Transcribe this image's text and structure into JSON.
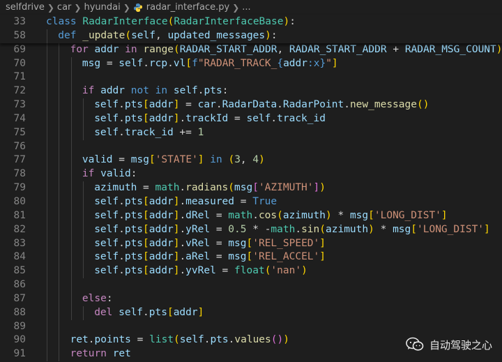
{
  "breadcrumb": {
    "items": [
      "selfdrive",
      "car",
      "hyundai",
      "radar_interface.py",
      "..."
    ],
    "separator": ">"
  },
  "sticky_lines": [
    {
      "n": "33",
      "indent": 0,
      "tokens": [
        [
          "kw",
          "class "
        ],
        [
          "cls",
          "RadarInterface"
        ],
        [
          "b1",
          "("
        ],
        [
          "cls",
          "RadarInterfaceBase"
        ],
        [
          "b1",
          ")"
        ],
        [
          "pl",
          ":"
        ]
      ]
    },
    {
      "n": "58",
      "indent": 1,
      "tokens": [
        [
          "kw",
          "def "
        ],
        [
          "fn",
          "_update"
        ],
        [
          "b1",
          "("
        ],
        [
          "var",
          "self"
        ],
        [
          "pl",
          ", "
        ],
        [
          "var",
          "updated_messages"
        ],
        [
          "b1",
          ")"
        ],
        [
          "pl",
          ":"
        ]
      ]
    }
  ],
  "lines": [
    {
      "n": "69",
      "indent": 2,
      "tokens": [
        [
          "ctl",
          "for "
        ],
        [
          "var",
          "addr "
        ],
        [
          "ctl",
          "in "
        ],
        [
          "fn",
          "range"
        ],
        [
          "b1",
          "("
        ],
        [
          "var",
          "RADAR_START_ADDR"
        ],
        [
          "pl",
          ", "
        ],
        [
          "var",
          "RADAR_START_ADDR"
        ],
        [
          "pl",
          " + "
        ],
        [
          "var",
          "RADAR_MSG_COUNT"
        ],
        [
          "b1",
          ")"
        ],
        [
          "pl",
          ":"
        ]
      ]
    },
    {
      "n": "70",
      "indent": 3,
      "tokens": [
        [
          "var",
          "msg"
        ],
        [
          "pl",
          " = "
        ],
        [
          "var",
          "self"
        ],
        [
          "pl",
          "."
        ],
        [
          "var",
          "rcp"
        ],
        [
          "pl",
          "."
        ],
        [
          "var",
          "vl"
        ],
        [
          "b1",
          "["
        ],
        [
          "kw",
          "f"
        ],
        [
          "str",
          "\"RADAR_TRACK_"
        ],
        [
          "kw",
          "{"
        ],
        [
          "var",
          "addr"
        ],
        [
          "kw",
          ":x}"
        ],
        [
          "str",
          "\""
        ],
        [
          "b1",
          "]"
        ]
      ]
    },
    {
      "n": "71",
      "indent": 3,
      "tokens": []
    },
    {
      "n": "72",
      "indent": 3,
      "tokens": [
        [
          "ctl",
          "if "
        ],
        [
          "var",
          "addr "
        ],
        [
          "kw",
          "not in "
        ],
        [
          "var",
          "self"
        ],
        [
          "pl",
          "."
        ],
        [
          "var",
          "pts"
        ],
        [
          "pl",
          ":"
        ]
      ]
    },
    {
      "n": "73",
      "indent": 4,
      "tokens": [
        [
          "var",
          "self"
        ],
        [
          "pl",
          "."
        ],
        [
          "var",
          "pts"
        ],
        [
          "b1",
          "["
        ],
        [
          "var",
          "addr"
        ],
        [
          "b1",
          "]"
        ],
        [
          "pl",
          " = "
        ],
        [
          "var",
          "car"
        ],
        [
          "pl",
          "."
        ],
        [
          "var",
          "RadarData"
        ],
        [
          "pl",
          "."
        ],
        [
          "var",
          "RadarPoint"
        ],
        [
          "pl",
          "."
        ],
        [
          "fn",
          "new_message"
        ],
        [
          "b1",
          "()"
        ]
      ]
    },
    {
      "n": "74",
      "indent": 4,
      "tokens": [
        [
          "var",
          "self"
        ],
        [
          "pl",
          "."
        ],
        [
          "var",
          "pts"
        ],
        [
          "b1",
          "["
        ],
        [
          "var",
          "addr"
        ],
        [
          "b1",
          "]"
        ],
        [
          "pl",
          "."
        ],
        [
          "var",
          "trackId"
        ],
        [
          "pl",
          " = "
        ],
        [
          "var",
          "self"
        ],
        [
          "pl",
          "."
        ],
        [
          "var",
          "track_id"
        ]
      ]
    },
    {
      "n": "75",
      "indent": 4,
      "tokens": [
        [
          "var",
          "self"
        ],
        [
          "pl",
          "."
        ],
        [
          "var",
          "track_id"
        ],
        [
          "pl",
          " += "
        ],
        [
          "num",
          "1"
        ]
      ]
    },
    {
      "n": "76",
      "indent": 3,
      "tokens": []
    },
    {
      "n": "77",
      "indent": 3,
      "tokens": [
        [
          "var",
          "valid"
        ],
        [
          "pl",
          " = "
        ],
        [
          "var",
          "msg"
        ],
        [
          "b1",
          "["
        ],
        [
          "str",
          "'STATE'"
        ],
        [
          "b1",
          "]"
        ],
        [
          "kw",
          " in "
        ],
        [
          "b1",
          "("
        ],
        [
          "num",
          "3"
        ],
        [
          "pl",
          ", "
        ],
        [
          "num",
          "4"
        ],
        [
          "b1",
          ")"
        ]
      ]
    },
    {
      "n": "78",
      "indent": 3,
      "tokens": [
        [
          "ctl",
          "if "
        ],
        [
          "var",
          "valid"
        ],
        [
          "pl",
          ":"
        ]
      ]
    },
    {
      "n": "79",
      "indent": 4,
      "tokens": [
        [
          "var",
          "azimuth"
        ],
        [
          "pl",
          " = "
        ],
        [
          "cls",
          "math"
        ],
        [
          "pl",
          "."
        ],
        [
          "fn",
          "radians"
        ],
        [
          "b1",
          "("
        ],
        [
          "var",
          "msg"
        ],
        [
          "b2",
          "["
        ],
        [
          "str",
          "'AZIMUTH'"
        ],
        [
          "b2",
          "]"
        ],
        [
          "b1",
          ")"
        ]
      ]
    },
    {
      "n": "80",
      "indent": 4,
      "tokens": [
        [
          "var",
          "self"
        ],
        [
          "pl",
          "."
        ],
        [
          "var",
          "pts"
        ],
        [
          "b1",
          "["
        ],
        [
          "var",
          "addr"
        ],
        [
          "b1",
          "]"
        ],
        [
          "pl",
          "."
        ],
        [
          "var",
          "measured"
        ],
        [
          "pl",
          " = "
        ],
        [
          "kw",
          "True"
        ]
      ]
    },
    {
      "n": "81",
      "indent": 4,
      "tokens": [
        [
          "var",
          "self"
        ],
        [
          "pl",
          "."
        ],
        [
          "var",
          "pts"
        ],
        [
          "b1",
          "["
        ],
        [
          "var",
          "addr"
        ],
        [
          "b1",
          "]"
        ],
        [
          "pl",
          "."
        ],
        [
          "var",
          "dRel"
        ],
        [
          "pl",
          " = "
        ],
        [
          "cls",
          "math"
        ],
        [
          "pl",
          "."
        ],
        [
          "fn",
          "cos"
        ],
        [
          "b1",
          "("
        ],
        [
          "var",
          "azimuth"
        ],
        [
          "b1",
          ")"
        ],
        [
          "pl",
          " * "
        ],
        [
          "var",
          "msg"
        ],
        [
          "b1",
          "["
        ],
        [
          "str",
          "'LONG_DIST'"
        ],
        [
          "b1",
          "]"
        ]
      ]
    },
    {
      "n": "82",
      "indent": 4,
      "tokens": [
        [
          "var",
          "self"
        ],
        [
          "pl",
          "."
        ],
        [
          "var",
          "pts"
        ],
        [
          "b1",
          "["
        ],
        [
          "var",
          "addr"
        ],
        [
          "b1",
          "]"
        ],
        [
          "pl",
          "."
        ],
        [
          "var",
          "yRel"
        ],
        [
          "pl",
          " = "
        ],
        [
          "num",
          "0.5"
        ],
        [
          "pl",
          " * -"
        ],
        [
          "cls",
          "math"
        ],
        [
          "pl",
          "."
        ],
        [
          "fn",
          "sin"
        ],
        [
          "b1",
          "("
        ],
        [
          "var",
          "azimuth"
        ],
        [
          "b1",
          ")"
        ],
        [
          "pl",
          " * "
        ],
        [
          "var",
          "msg"
        ],
        [
          "b1",
          "["
        ],
        [
          "str",
          "'LONG_DIST'"
        ],
        [
          "b1",
          "]"
        ]
      ]
    },
    {
      "n": "83",
      "indent": 4,
      "tokens": [
        [
          "var",
          "self"
        ],
        [
          "pl",
          "."
        ],
        [
          "var",
          "pts"
        ],
        [
          "b1",
          "["
        ],
        [
          "var",
          "addr"
        ],
        [
          "b1",
          "]"
        ],
        [
          "pl",
          "."
        ],
        [
          "var",
          "vRel"
        ],
        [
          "pl",
          " = "
        ],
        [
          "var",
          "msg"
        ],
        [
          "b1",
          "["
        ],
        [
          "str",
          "'REL_SPEED'"
        ],
        [
          "b1",
          "]"
        ]
      ]
    },
    {
      "n": "84",
      "indent": 4,
      "tokens": [
        [
          "var",
          "self"
        ],
        [
          "pl",
          "."
        ],
        [
          "var",
          "pts"
        ],
        [
          "b1",
          "["
        ],
        [
          "var",
          "addr"
        ],
        [
          "b1",
          "]"
        ],
        [
          "pl",
          "."
        ],
        [
          "var",
          "aRel"
        ],
        [
          "pl",
          " = "
        ],
        [
          "var",
          "msg"
        ],
        [
          "b1",
          "["
        ],
        [
          "str",
          "'REL_ACCEL'"
        ],
        [
          "b1",
          "]"
        ]
      ]
    },
    {
      "n": "85",
      "indent": 4,
      "tokens": [
        [
          "var",
          "self"
        ],
        [
          "pl",
          "."
        ],
        [
          "var",
          "pts"
        ],
        [
          "b1",
          "["
        ],
        [
          "var",
          "addr"
        ],
        [
          "b1",
          "]"
        ],
        [
          "pl",
          "."
        ],
        [
          "var",
          "yvRel"
        ],
        [
          "pl",
          " = "
        ],
        [
          "cls",
          "float"
        ],
        [
          "b1",
          "("
        ],
        [
          "str",
          "'nan'"
        ],
        [
          "b1",
          ")"
        ]
      ]
    },
    {
      "n": "86",
      "indent": 3,
      "tokens": []
    },
    {
      "n": "87",
      "indent": 3,
      "tokens": [
        [
          "ctl",
          "else"
        ],
        [
          "pl",
          ":"
        ]
      ]
    },
    {
      "n": "88",
      "indent": 4,
      "tokens": [
        [
          "ctl",
          "del "
        ],
        [
          "var",
          "self"
        ],
        [
          "pl",
          "."
        ],
        [
          "var",
          "pts"
        ],
        [
          "b1",
          "["
        ],
        [
          "var",
          "addr"
        ],
        [
          "b1",
          "]"
        ]
      ]
    },
    {
      "n": "89",
      "indent": 2,
      "tokens": []
    },
    {
      "n": "90",
      "indent": 2,
      "tokens": [
        [
          "var",
          "ret"
        ],
        [
          "pl",
          "."
        ],
        [
          "var",
          "points"
        ],
        [
          "pl",
          " = "
        ],
        [
          "cls",
          "list"
        ],
        [
          "b1",
          "("
        ],
        [
          "var",
          "self"
        ],
        [
          "pl",
          "."
        ],
        [
          "var",
          "pts"
        ],
        [
          "pl",
          "."
        ],
        [
          "fn",
          "values"
        ],
        [
          "b2",
          "()"
        ],
        [
          "b1",
          ")"
        ]
      ]
    },
    {
      "n": "91",
      "indent": 2,
      "tokens": [
        [
          "ctl",
          "return "
        ],
        [
          "var",
          "ret"
        ]
      ]
    }
  ],
  "watermark": {
    "text": "自动驾驶之心",
    "icon": "wechat-icon"
  },
  "colors": {
    "background": "#1e1e1e",
    "keyword": "#569cd6",
    "control": "#c586c0",
    "class": "#4ec9b0",
    "function": "#dcdcaa",
    "variable": "#9cdcfe",
    "number": "#b5cea8",
    "string": "#ce9178",
    "line_number": "#858585"
  }
}
